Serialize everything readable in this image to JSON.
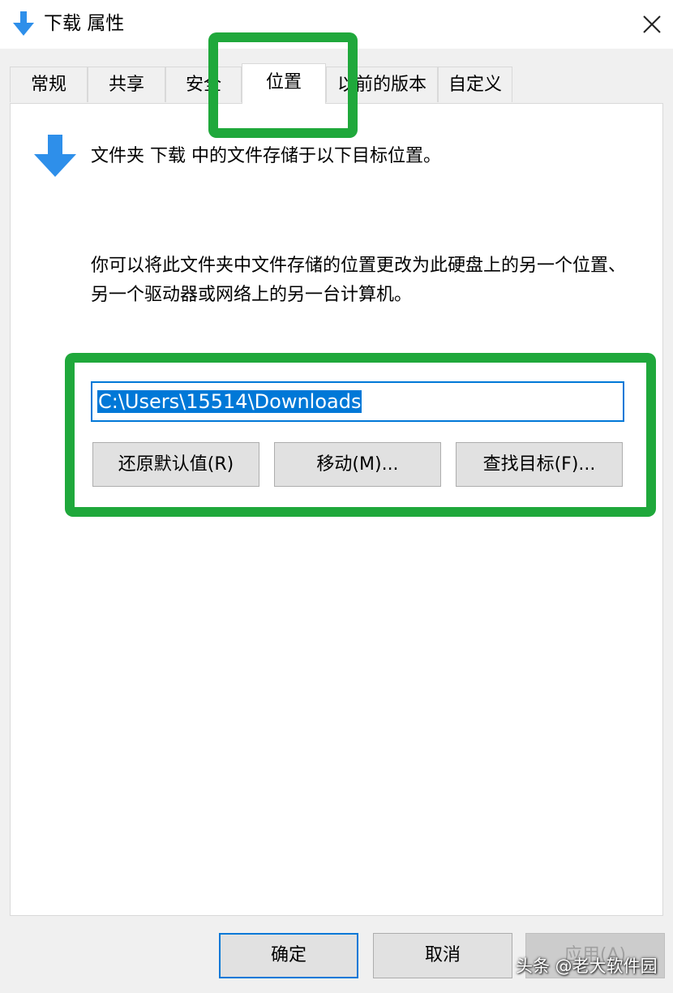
{
  "window": {
    "title": "下载 属性",
    "icon": "download-arrow-icon",
    "close_icon": "close-icon"
  },
  "tabs": [
    {
      "label": "常规",
      "active": false
    },
    {
      "label": "共享",
      "active": false
    },
    {
      "label": "安全",
      "active": false
    },
    {
      "label": "位置",
      "active": true
    },
    {
      "label": "以前的版本",
      "active": false
    },
    {
      "label": "自定义",
      "active": false
    }
  ],
  "location_panel": {
    "summary": "文件夹 下载 中的文件存储于以下目标位置。",
    "description": "你可以将此文件夹中文件存储的位置更改为此硬盘上的另一个位置、另一个驱动器或网络上的另一台计算机。",
    "path_value": "C:\\Users\\15514\\Downloads",
    "restore_default_label": "还原默认值(R)",
    "move_label": "移动(M)...",
    "find_target_label": "查找目标(F)..."
  },
  "footer": {
    "ok_label": "确定",
    "cancel_label": "取消",
    "apply_label": "应用(A)",
    "apply_enabled": false
  },
  "watermark": "头条 @老大软件园",
  "colors": {
    "accent": "#0078d7",
    "icon_blue": "#2e8fea",
    "annotation_green": "#1fa83b",
    "dialog_bg": "#f0f0f0"
  }
}
